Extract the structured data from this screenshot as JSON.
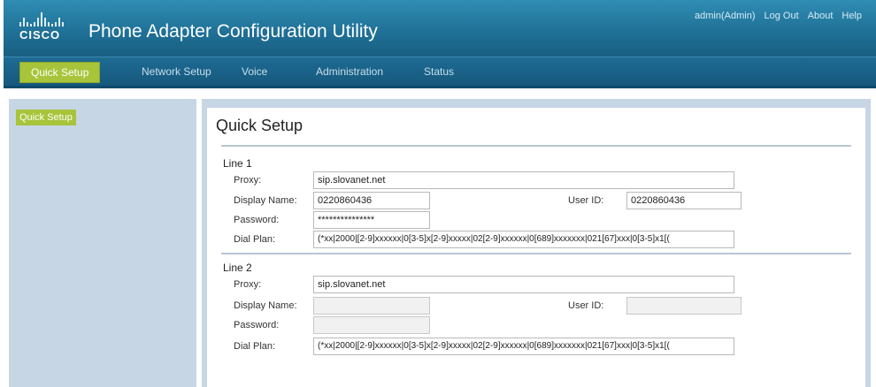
{
  "header": {
    "brand": "CISCO",
    "title": "Phone Adapter Configuration Utility",
    "links": {
      "user": "admin(Admin)",
      "logout": "Log Out",
      "about": "About",
      "help": "Help"
    }
  },
  "nav": {
    "tabs": [
      "Quick Setup",
      "Network Setup",
      "Voice",
      "Administration",
      "Status"
    ],
    "active": "Quick Setup"
  },
  "sidebar": {
    "items": [
      "Quick Setup"
    ]
  },
  "page": {
    "title": "Quick Setup",
    "labels": {
      "proxy": "Proxy:",
      "display_name": "Display Name:",
      "user_id": "User ID:",
      "password": "Password:",
      "dial_plan": "Dial Plan:"
    },
    "lines": [
      {
        "title": "Line 1",
        "proxy": "sip.slovanet.net",
        "display_name": "0220860436",
        "user_id": "0220860436",
        "password": "***************",
        "dial_plan": "(*xx|2000|[2-9]xxxxxx|0[3-5]x[2-9]xxxxx|02[2-9]xxxxxx|0[689]xxxxxxx|021[67]xxx|0[3-5]x1[("
      },
      {
        "title": "Line 2",
        "proxy": "sip.slovanet.net",
        "display_name": "",
        "user_id": "",
        "password": "",
        "dial_plan": "(*xx|2000|[2-9]xxxxxx|0[3-5]x[2-9]xxxxx|02[2-9]xxxxxx|0[689]xxxxxxx|021[67]xxx|0[3-5]x1[("
      }
    ]
  },
  "colors": {
    "header": "#2f8cb3",
    "nav": "#1e6b94",
    "active_tab": "#a7c43a",
    "frame": "#c7d6e5"
  }
}
